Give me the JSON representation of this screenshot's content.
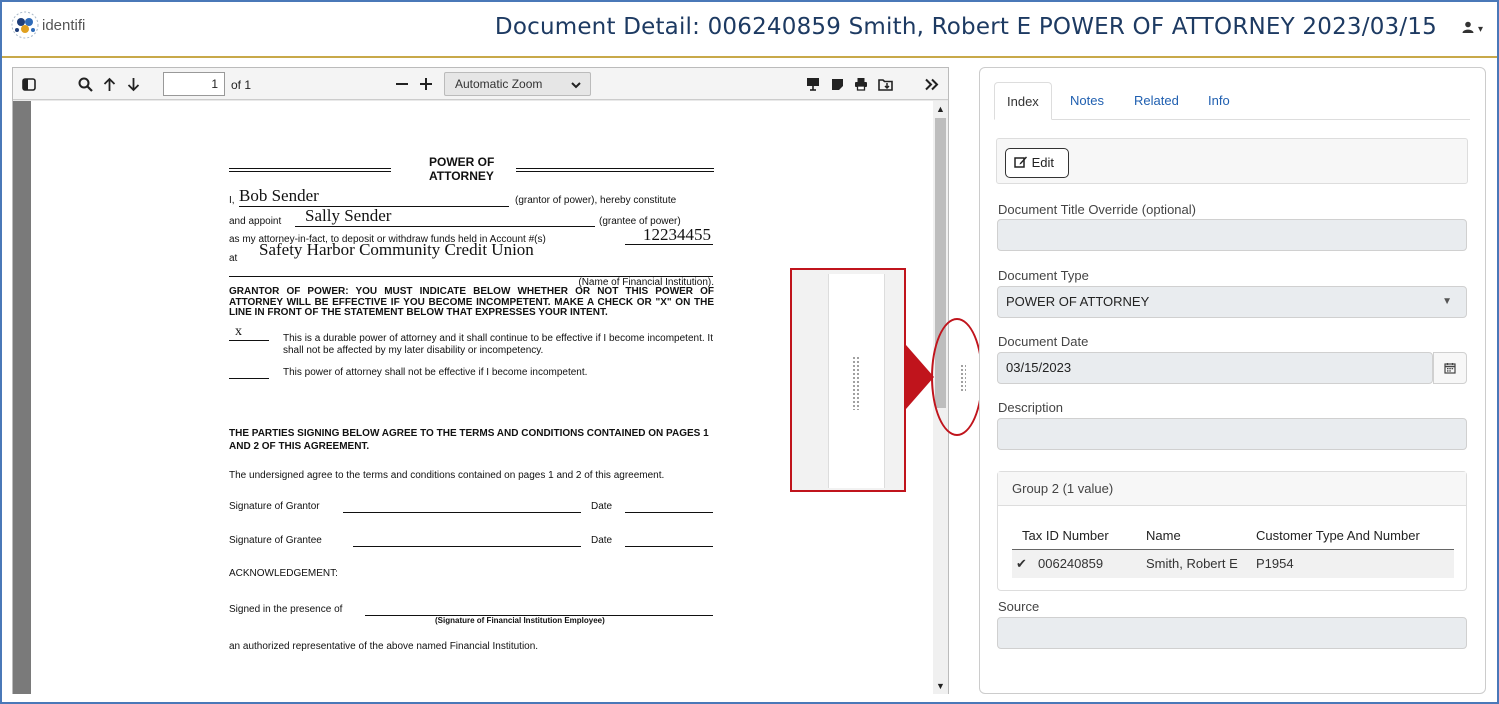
{
  "header": {
    "logo_text": "identifi",
    "title": "Document Detail: 006240859 Smith, Robert E POWER OF ATTORNEY 2023/03/15",
    "user_menu": "▾"
  },
  "viewer": {
    "page_current": "1",
    "page_total": "of 1",
    "zoom": "Automatic Zoom"
  },
  "document": {
    "title_line1": "POWER OF",
    "title_line2": "ATTORNEY",
    "i_prefix": "I,",
    "grantor_name": "Bob Sender",
    "grantor_suffix": "(grantor of power), hereby constitute",
    "appoint_prefix": "and appoint",
    "grantee_name": "Sally Sender",
    "grantee_suffix": "(grantee of power)",
    "account_line": "as my attorney-in-fact, to deposit or withdraw funds held in Account #(s)",
    "account_number": "12234455",
    "at_prefix": "at",
    "institution": "Safety Harbor  Community Credit Union",
    "institution_label": "(Name of Financial Institution).",
    "grantor_notice": "GRANTOR OF POWER: YOU MUST INDICATE BELOW WHETHER OR NOT THIS POWER OF ATTORNEY WILL BE EFFECTIVE IF YOU BECOME INCOMPETENT. MAKE A CHECK OR \"X\" ON THE LINE IN FRONT OF THE STATEMENT BELOW THAT EXPRESSES YOUR INTENT.",
    "mark": "x",
    "option1": "This is a durable power of attorney and it shall continue to be effective if I become incompetent. It shall not be affected by my later disability or incompetency.",
    "option2": "This power of attorney shall not be effective if I become incompetent.",
    "parties_heading": "THE PARTIES SIGNING BELOW AGREE TO THE TERMS AND CONDITIONS CONTAINED ON PAGES 1 AND 2 OF THIS AGREEMENT.",
    "agree_text": "The undersigned agree to the terms and conditions contained on pages 1 and 2 of this agreement.",
    "sig_grantor": "Signature of Grantor",
    "sig_grantee": "Signature of Grantee",
    "date_label": "Date",
    "ack": "ACKNOWLEDGEMENT:",
    "signed_presence": "Signed in the presence of",
    "employee_sig": "(Signature of Financial Institution Employee)",
    "representative": "an authorized representative of the above named Financial Institution."
  },
  "panel": {
    "tabs": [
      {
        "label": "Index"
      },
      {
        "label": "Notes"
      },
      {
        "label": "Related"
      },
      {
        "label": "Info"
      }
    ],
    "edit_label": "Edit",
    "fields": {
      "title_override_label": "Document Title Override (optional)",
      "title_override_value": "",
      "doc_type_label": "Document Type",
      "doc_type_value": "POWER OF ATTORNEY",
      "doc_date_label": "Document Date",
      "doc_date_value": "03/15/2023",
      "description_label": "Description",
      "description_value": "",
      "source_label": "Source",
      "source_value": ""
    },
    "group": {
      "title": "Group 2 (1 value)",
      "columns": [
        "Tax ID Number",
        "Name",
        "Customer Type And Number"
      ],
      "rows": [
        {
          "check": "✔",
          "tax_id": "006240859",
          "name": "Smith, Robert E",
          "customer": "P1954"
        }
      ]
    }
  },
  "colors": {
    "title": "#1d3a62",
    "header_rule": "#c8a94a",
    "callout": "#c0141c",
    "link": "#1f5fb0"
  }
}
